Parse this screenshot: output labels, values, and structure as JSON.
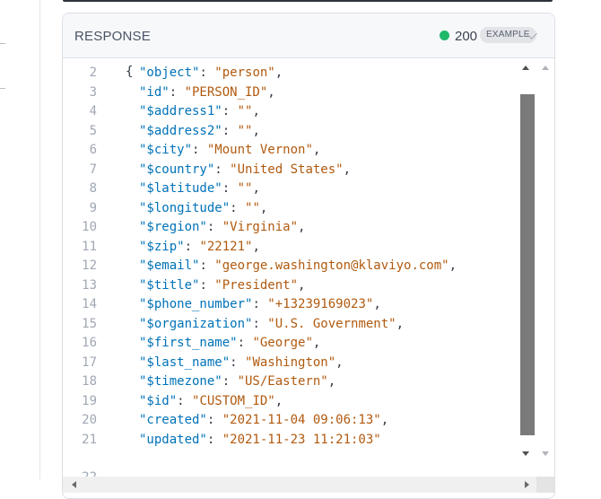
{
  "panel": {
    "title": "RESPONSE",
    "status_code": "200",
    "status_color": "#1fb96a",
    "badge": "EXAMPLE",
    "icons": {
      "expand": "chevron-down-icon"
    }
  },
  "code": {
    "lines": [
      {
        "n": "2",
        "key": "object",
        "value": "person"
      },
      {
        "n": "3",
        "key": "id",
        "value": "PERSON_ID"
      },
      {
        "n": "4",
        "key": "$address1",
        "value": ""
      },
      {
        "n": "5",
        "key": "$address2",
        "value": ""
      },
      {
        "n": "6",
        "key": "$city",
        "value": "Mount Vernon"
      },
      {
        "n": "7",
        "key": "$country",
        "value": "United States"
      },
      {
        "n": "8",
        "key": "$latitude",
        "value": ""
      },
      {
        "n": "9",
        "key": "$longitude",
        "value": ""
      },
      {
        "n": "10",
        "key": "$region",
        "value": "Virginia"
      },
      {
        "n": "11",
        "key": "$zip",
        "value": "22121"
      },
      {
        "n": "12",
        "key": "$email",
        "value": "george.washington@klaviyo.com"
      },
      {
        "n": "13",
        "key": "$title",
        "value": "President"
      },
      {
        "n": "14",
        "key": "$phone_number",
        "value": "+13239169023"
      },
      {
        "n": "15",
        "key": "$organization",
        "value": "U.S. Government"
      },
      {
        "n": "16",
        "key": "$first_name",
        "value": "George"
      },
      {
        "n": "17",
        "key": "$last_name",
        "value": "Washington"
      },
      {
        "n": "18",
        "key": "$timezone",
        "value": "US/Eastern"
      },
      {
        "n": "19",
        "key": "$id",
        "value": "CUSTOM_ID"
      },
      {
        "n": "20",
        "key": "created",
        "value": "2021-11-04 09:06:13"
      },
      {
        "n": "21",
        "key": "updated",
        "value": "2021-11-23 11:21:03"
      }
    ],
    "closing": {
      "n": "22",
      "text": "}"
    }
  }
}
